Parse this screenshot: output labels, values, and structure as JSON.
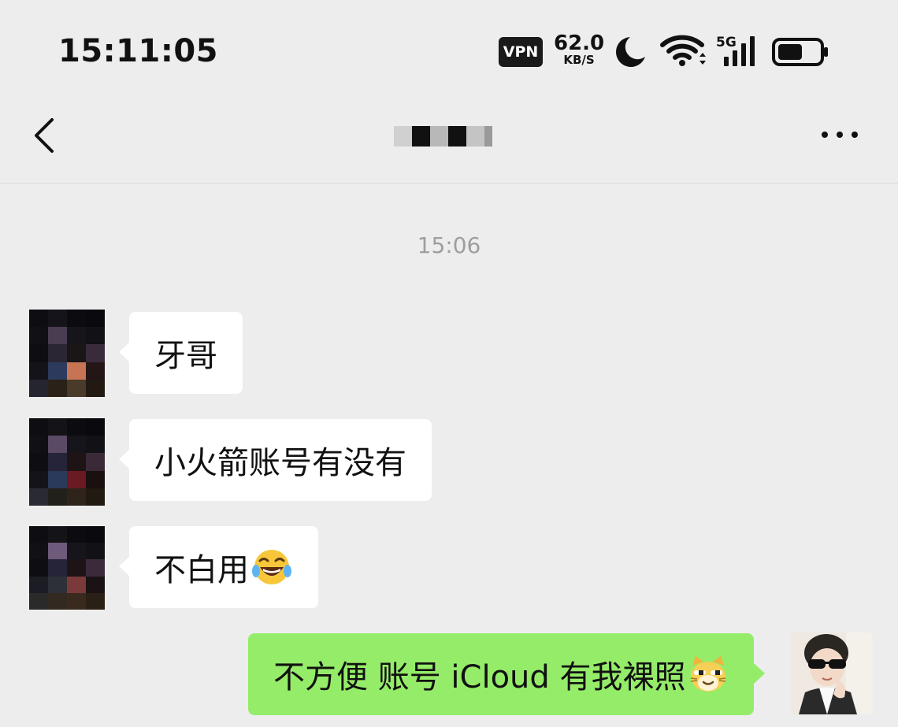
{
  "status_bar": {
    "time": "15:11:05",
    "vpn_label": "VPN",
    "net_speed_value": "62.0",
    "net_speed_unit": "KB/S",
    "network_type": "5G",
    "icons": [
      "moon-icon",
      "wifi-icon",
      "signal-icon",
      "battery-icon"
    ]
  },
  "nav": {
    "back_icon": "chevron-left-icon",
    "title": "",
    "more_icon": "more-dots-icon"
  },
  "chat": {
    "timestamp": "15:06",
    "messages": [
      {
        "sender": "other",
        "text": "牙哥"
      },
      {
        "sender": "other",
        "text": "小火箭账号有没有"
      },
      {
        "sender": "other",
        "text": "不白用",
        "emoji": "tears-of-joy-emoji"
      },
      {
        "sender": "me",
        "text": "不方便 账号 iCloud 有我裸照",
        "emoji": "smirk-cat-emoji"
      }
    ]
  },
  "colors": {
    "background": "#ededed",
    "bubble_other": "#ffffff",
    "bubble_me": "#95ec69",
    "timestamp": "#9e9e9e"
  }
}
